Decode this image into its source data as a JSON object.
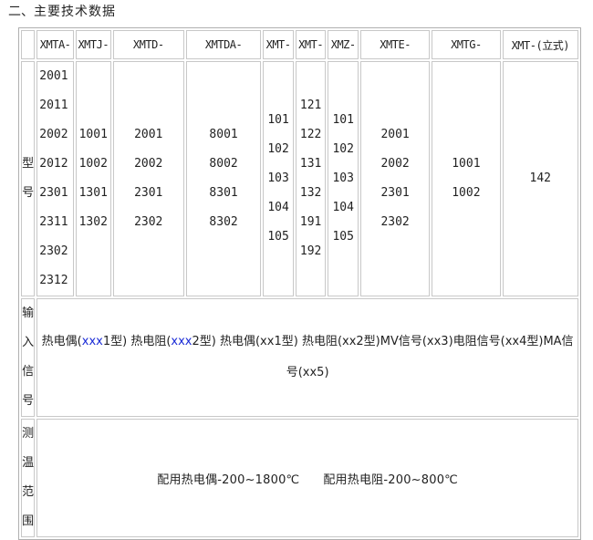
{
  "heading": {
    "num": "二、",
    "title": "主要技术数据"
  },
  "columns": [
    "XMTA-",
    "XMTJ-",
    "XMTD-",
    "XMTDA-",
    "XMT-",
    "XMT-",
    "XMZ-",
    "XMTE-",
    "XMTG-",
    "XMT-(立式)"
  ],
  "rows": {
    "model_label": [
      "型",
      "号"
    ],
    "models": [
      [
        "2001",
        "2011",
        "2002",
        "2012",
        "2301",
        "2311",
        "2302",
        "2312"
      ],
      [
        "1001",
        "1002",
        "1301",
        "1302"
      ],
      [
        "2001",
        "2002",
        "2301",
        "2302"
      ],
      [
        "8001",
        "8002",
        "8301",
        "8302"
      ],
      [
        "101",
        "102",
        "103",
        "104",
        "105"
      ],
      [
        "121",
        "122",
        "131",
        "132",
        "191",
        "192"
      ],
      [
        "101",
        "102",
        "103",
        "104",
        "105"
      ],
      [
        "2001",
        "2002",
        "2301",
        "2302"
      ],
      [
        "1001",
        "1002"
      ],
      [
        "142"
      ]
    ],
    "input_label": [
      "输",
      "入",
      "信",
      "号"
    ],
    "input": {
      "a1": "热电偶(",
      "a2": "xxx",
      "a3": "1型)",
      "b1": "热电阻(",
      "b2": "xxx",
      "b3": "2型)",
      "c": "热电偶(xx1型)",
      "d": "热电阻(xx2型)MV信号(xx3)电阻信号(xx4型)MA信号(xx5)"
    },
    "range_label": [
      "测",
      "温",
      "范",
      "围"
    ],
    "range": {
      "a": "配用热电偶-200~1800℃",
      "b": "配用热电阻-200~800℃"
    }
  }
}
